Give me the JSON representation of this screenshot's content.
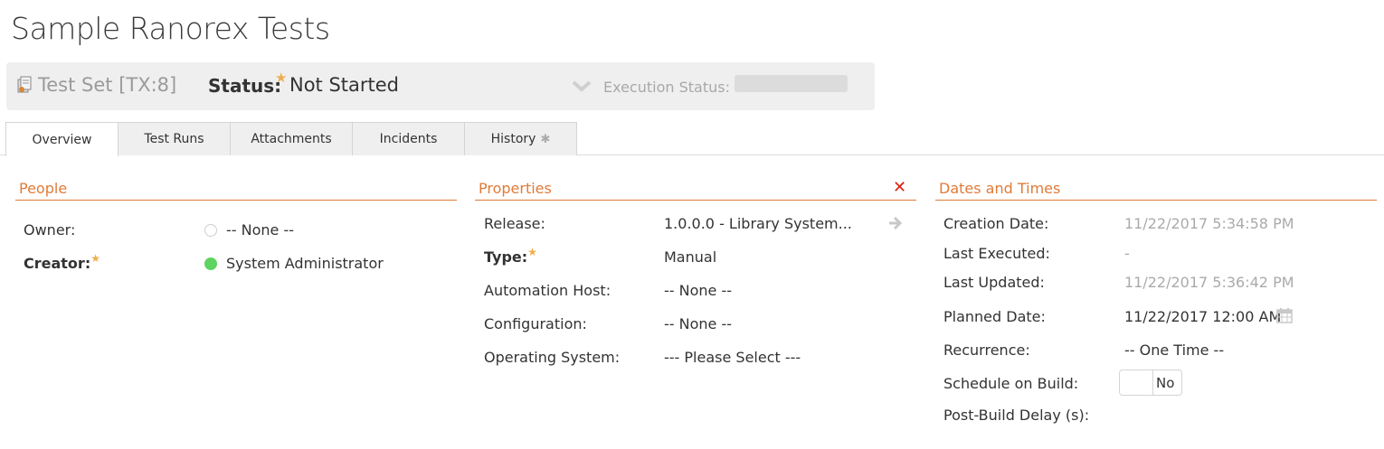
{
  "page": {
    "title": "Sample Ranorex Tests"
  },
  "header": {
    "artifact_type": "Test Set [TX:8]",
    "status_label": "Status:",
    "status_value": "Not Started",
    "execution_status_label": "Execution Status:",
    "execution_status_progress": 0
  },
  "tabs": [
    {
      "label": "Overview",
      "active": true
    },
    {
      "label": "Test Runs",
      "active": false
    },
    {
      "label": "Attachments",
      "active": false
    },
    {
      "label": "Incidents",
      "active": false
    },
    {
      "label": "History",
      "active": false
    }
  ],
  "people": {
    "title": "People",
    "owner_label": "Owner:",
    "owner_value": "-- None --",
    "creator_label": "Creator:",
    "creator_value": "System Administrator"
  },
  "properties": {
    "title": "Properties",
    "release_label": "Release:",
    "release_value": "1.0.0.0 - Library System...",
    "type_label": "Type:",
    "type_value": "Manual",
    "automation_host_label": "Automation Host:",
    "automation_host_value": "-- None --",
    "configuration_label": "Configuration:",
    "configuration_value": "-- None --",
    "os_label": "Operating System:",
    "os_value": "--- Please Select ---"
  },
  "dates": {
    "title": "Dates and Times",
    "creation_label": "Creation Date:",
    "creation_value": "11/22/2017 5:34:58 PM",
    "last_executed_label": "Last Executed:",
    "last_executed_value": "-",
    "last_updated_label": "Last Updated:",
    "last_updated_value": "11/22/2017 5:36:42 PM",
    "planned_label": "Planned Date:",
    "planned_value": "11/22/2017 12:00 AM",
    "recurrence_label": "Recurrence:",
    "recurrence_value": "-- One Time --",
    "schedule_label": "Schedule on Build:",
    "schedule_value": "No",
    "delay_label": "Post-Build Delay (s):"
  },
  "colors": {
    "accent": "#e07b39",
    "required_star": "#f0ad4e",
    "close": "#d9230f",
    "active_user": "#5fd35f"
  }
}
